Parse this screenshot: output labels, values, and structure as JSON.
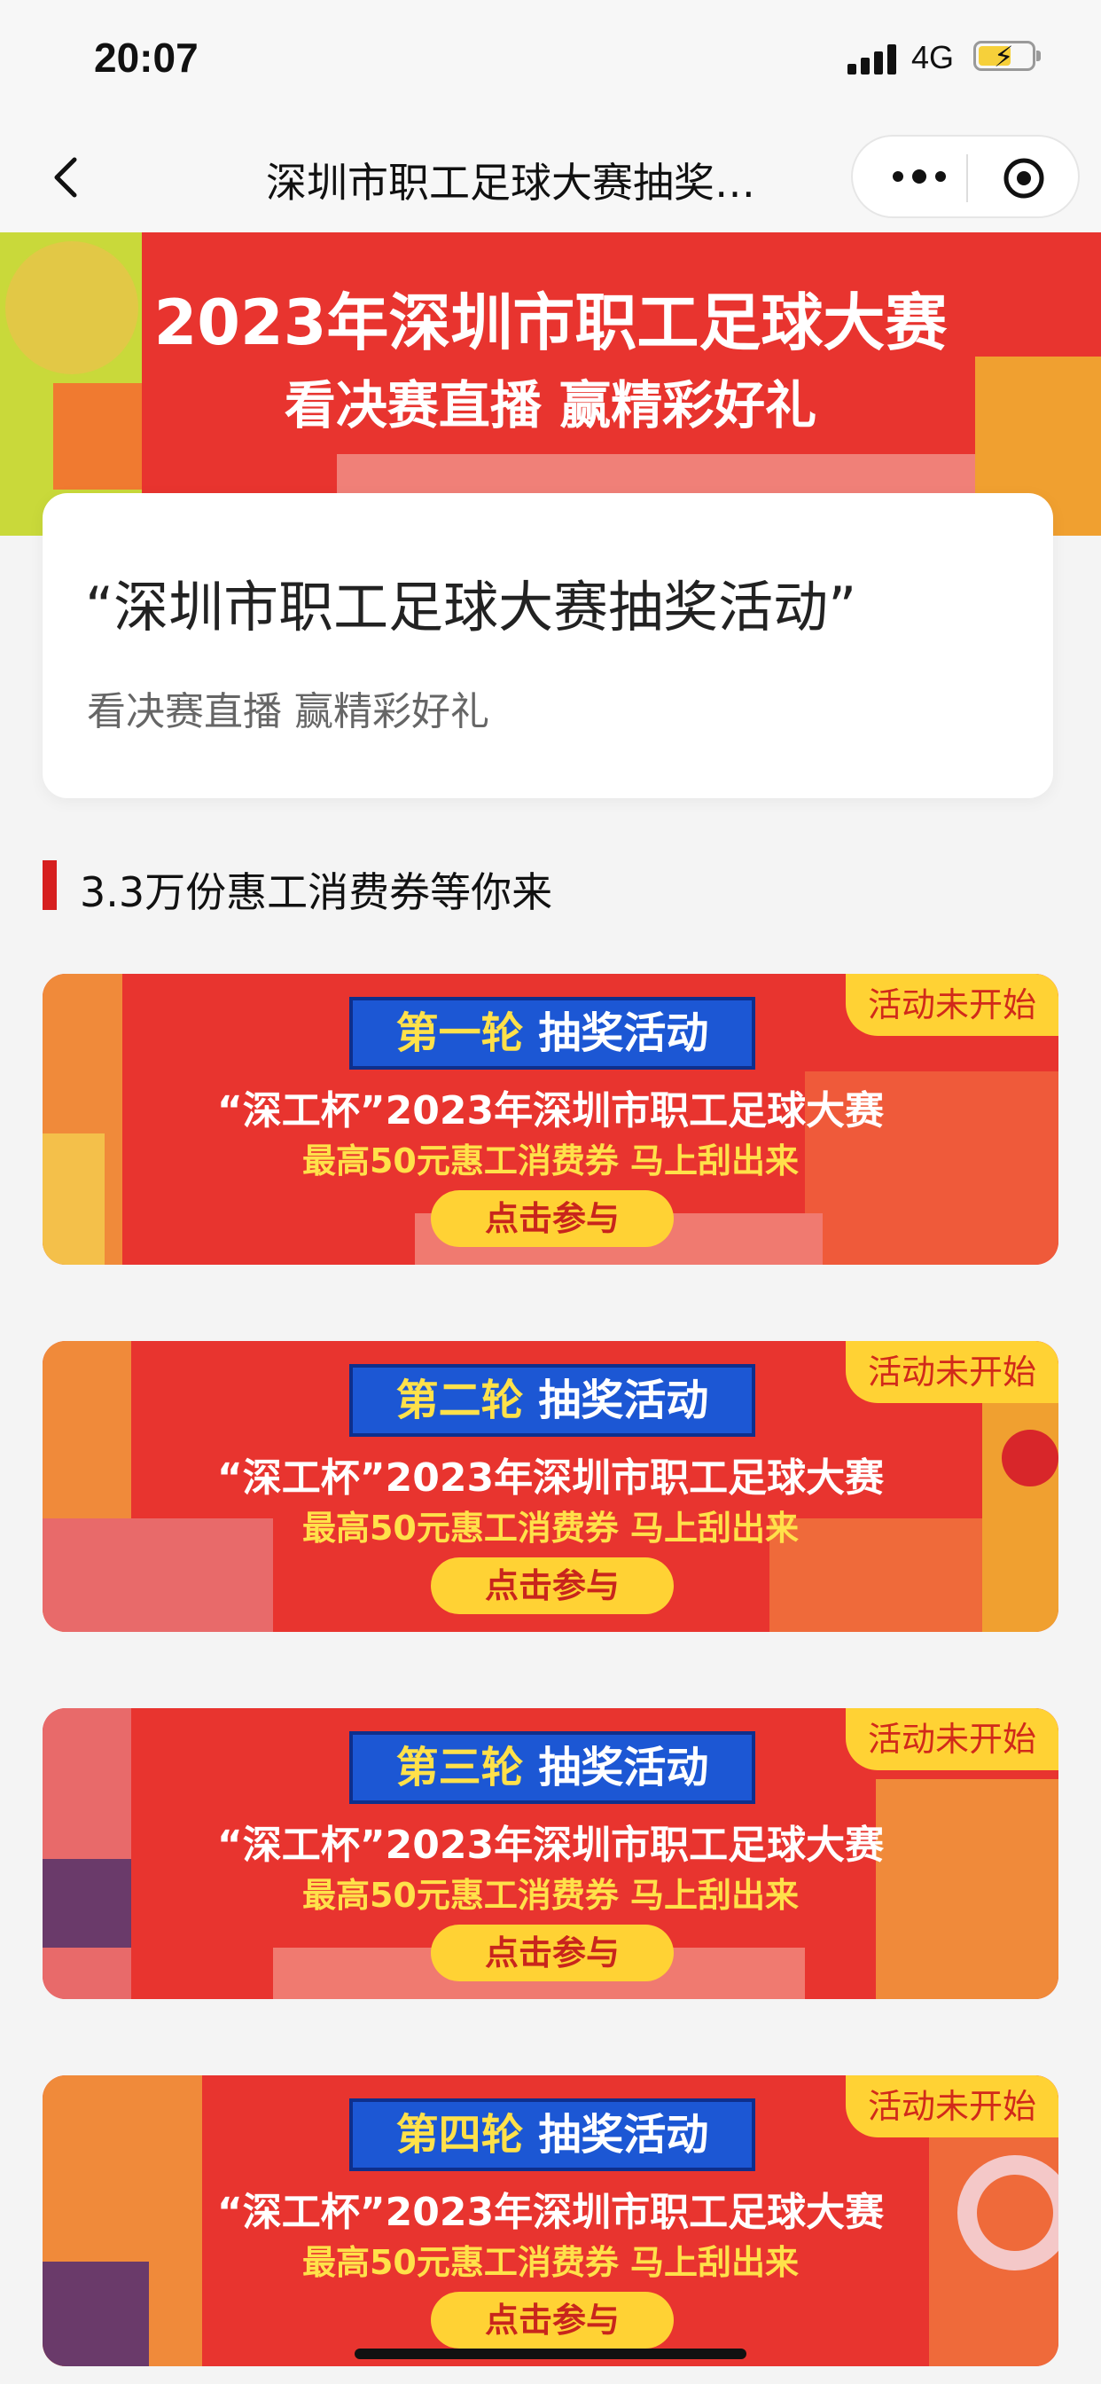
{
  "status_bar": {
    "time": "20:07",
    "network": "4G"
  },
  "nav": {
    "title": "深圳市职工足球大赛抽奖…"
  },
  "hero": {
    "line1": "2023年深圳市职工足球大赛",
    "line2": "看决赛直播 赢精彩好礼"
  },
  "info": {
    "title": "“深圳市职工足球大赛抽奖活动”",
    "subtitle": "看决赛直播 赢精彩好礼"
  },
  "section": {
    "title": "3.3万份惠工消费券等你来"
  },
  "lotteries": [
    {
      "status": "活动未开始",
      "round": "第一轮",
      "activity": "抽奖活动",
      "title": "“深工杯”2023年深圳市职工足球大赛",
      "subtitle": "最高50元惠工消费券 马上刮出来",
      "button": "点击参与"
    },
    {
      "status": "活动未开始",
      "round": "第二轮",
      "activity": "抽奖活动",
      "title": "“深工杯”2023年深圳市职工足球大赛",
      "subtitle": "最高50元惠工消费券 马上刮出来",
      "button": "点击参与"
    },
    {
      "status": "活动未开始",
      "round": "第三轮",
      "activity": "抽奖活动",
      "title": "“深工杯”2023年深圳市职工足球大赛",
      "subtitle": "最高50元惠工消费券 马上刮出来",
      "button": "点击参与"
    },
    {
      "status": "活动未开始",
      "round": "第四轮",
      "activity": "抽奖活动",
      "title": "“深工杯”2023年深圳市职工足球大赛",
      "subtitle": "最高50元惠工消费券 马上刮出来",
      "button": "点击参与"
    }
  ],
  "colors": {
    "accent_red": "#d61f1f",
    "banner_red": "#e8342f",
    "yellow": "#ffd234",
    "blue": "#1c57d4"
  }
}
